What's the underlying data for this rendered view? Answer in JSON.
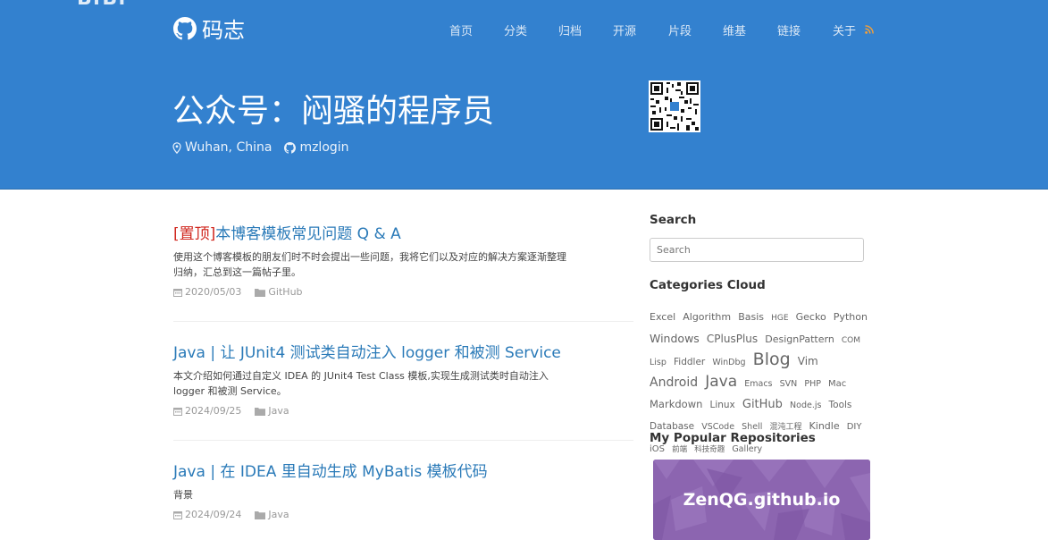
{
  "watermark": "BfBf",
  "site": {
    "name": "码志",
    "logo_icon": "github-icon"
  },
  "nav": {
    "items": [
      "首页",
      "分类",
      "归档",
      "开源",
      "片段",
      "维基",
      "链接",
      "关于"
    ],
    "rss_icon": "rss-icon"
  },
  "hero": {
    "title": "公众号：闷骚的程序员",
    "location": "Wuhan, China",
    "github_user": "mzlogin"
  },
  "posts": [
    {
      "pin_label": "[置顶]",
      "title": "本博客模板常见问题 Q & A",
      "excerpt": "使用这个博客模板的朋友们时不时会提出一些问题，我将它们以及对应的解决方案逐渐整理归纳，汇总到这一篇帖子里。",
      "date": "2020/05/03",
      "category": "GitHub"
    },
    {
      "pin_label": "",
      "title": "Java | 让 JUnit4 测试类自动注入 logger 和被测 Service",
      "excerpt": "本文介绍如何通过自定义 IDEA 的 JUnit4 Test Class 模板,实现生成测试类时自动注入 logger 和被测 Service。",
      "date": "2024/09/25",
      "category": "Java"
    },
    {
      "pin_label": "",
      "title": "Java | 在 IDEA 里自动生成 MyBatis 模板代码",
      "excerpt": "背景",
      "date": "2024/09/24",
      "category": "Java"
    }
  ],
  "sidebar": {
    "search_heading": "Search",
    "search_placeholder": "Search",
    "categories_heading": "Categories Cloud",
    "tags": [
      "Excel",
      "Algorithm",
      "Basis",
      "HGE",
      "Gecko",
      "Python",
      "Windows",
      "CPlusPlus",
      "DesignPattern",
      "COM",
      "Lisp",
      "Fiddler",
      "WinDbg",
      "Blog",
      "Vim",
      "Android",
      "Java",
      "Emacs",
      "SVN",
      "PHP",
      "Mac",
      "Markdown",
      "Linux",
      "GitHub",
      "Node.js",
      "Tools",
      "Database",
      "VSCode",
      "Shell",
      "混沌工程",
      "Kindle",
      "DIY",
      "iOS",
      "前端",
      "科技奇趣",
      "Gallery"
    ],
    "repos_heading": "My Popular Repositories",
    "repo_name": "ZenQG.github.io"
  },
  "colors": {
    "header_bg": "#3381cf",
    "link": "#2a7ab8",
    "pin": "#d0261e",
    "repo_card": "#8c65b0"
  }
}
